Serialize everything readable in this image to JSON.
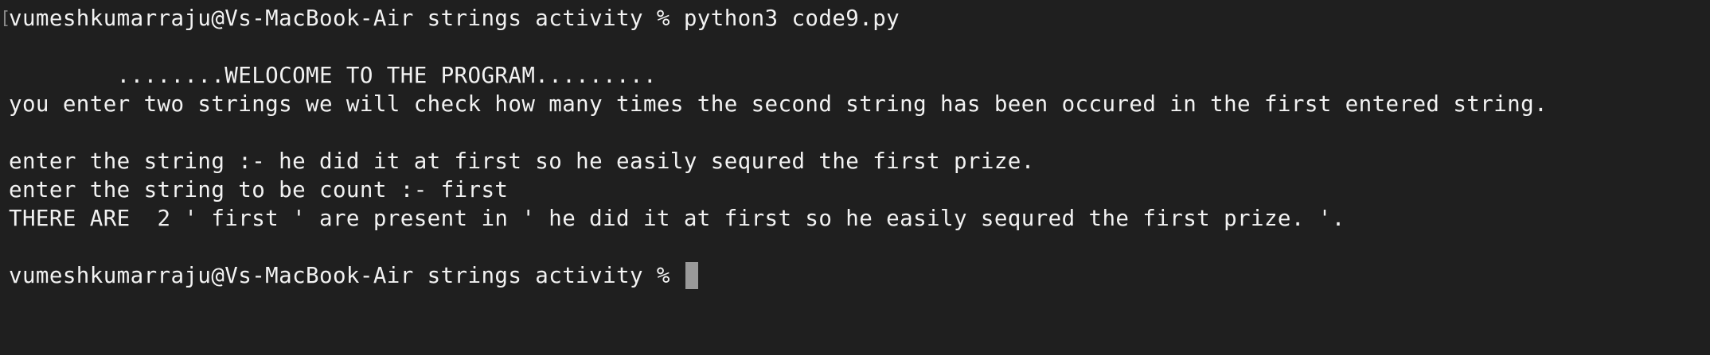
{
  "terminal": {
    "bracket": "[",
    "lines": [
      "vumeshkumarraju@Vs-MacBook-Air strings activity % python3 code9.py",
      "",
      "        ........WELOCOME TO THE PROGRAM.........",
      "you enter two strings we will check how many times the second string has been occured in the first entered string.",
      "",
      "enter the string :- he did it at first so he easily sequred the first prize.",
      "enter the string to be count :- first",
      "THERE ARE  2 ' first ' are present in ' he did it at first so he easily sequred the first prize. '.",
      "",
      "vumeshkumarraju@Vs-MacBook-Air strings activity % "
    ]
  }
}
